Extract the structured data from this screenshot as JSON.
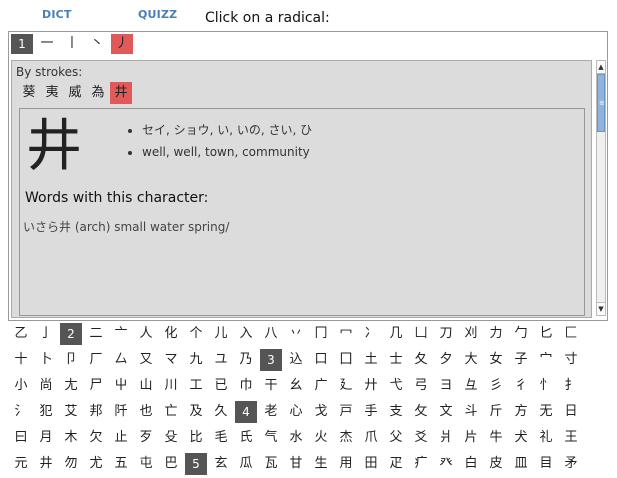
{
  "nav": {
    "dict": "DICT",
    "quizz": "QUIZZ"
  },
  "prompt": "Click on a radical:",
  "radicals": [
    {
      "text": "1",
      "kind": "num"
    },
    {
      "text": "一",
      "kind": "item"
    },
    {
      "text": "丨",
      "kind": "item"
    },
    {
      "text": "丶",
      "kind": "item"
    },
    {
      "text": "丿",
      "kind": "sel"
    }
  ],
  "panel": {
    "by_strokes_label": "By strokes:",
    "candidates": [
      {
        "text": "葵",
        "sel": false
      },
      {
        "text": "夷",
        "sel": false
      },
      {
        "text": "威",
        "sel": false
      },
      {
        "text": "為",
        "sel": false
      },
      {
        "text": "井",
        "sel": true
      }
    ],
    "detail": {
      "kanji": "井",
      "readings": "セイ, ショウ, い, いの, さい, ひ",
      "meanings": "well, well, town, community",
      "words_title": "Words with this character:",
      "words": [
        "いさら井 (arch) small water spring/"
      ]
    }
  },
  "grid_rows": [
    [
      {
        "t": "乙"
      },
      {
        "t": "亅"
      },
      {
        "t": "2",
        "n": true
      },
      {
        "t": "二"
      },
      {
        "t": "亠"
      },
      {
        "t": "人"
      },
      {
        "t": "化"
      },
      {
        "t": "个"
      },
      {
        "t": "儿"
      },
      {
        "t": "入"
      },
      {
        "t": "八"
      },
      {
        "t": "丷"
      },
      {
        "t": "冂"
      },
      {
        "t": "冖"
      },
      {
        "t": "冫"
      },
      {
        "t": "几"
      },
      {
        "t": "凵"
      },
      {
        "t": "刀"
      },
      {
        "t": "刈"
      },
      {
        "t": "力"
      },
      {
        "t": "勹"
      },
      {
        "t": "匕"
      },
      {
        "t": "匚"
      }
    ],
    [
      {
        "t": "十"
      },
      {
        "t": "卜"
      },
      {
        "t": "卩"
      },
      {
        "t": "厂"
      },
      {
        "t": "厶"
      },
      {
        "t": "又"
      },
      {
        "t": "マ"
      },
      {
        "t": "九"
      },
      {
        "t": "ユ"
      },
      {
        "t": "乃"
      },
      {
        "t": "3",
        "n": true
      },
      {
        "t": "込"
      },
      {
        "t": "口"
      },
      {
        "t": "囗"
      },
      {
        "t": "土"
      },
      {
        "t": "士"
      },
      {
        "t": "夂"
      },
      {
        "t": "夕"
      },
      {
        "t": "大"
      },
      {
        "t": "女"
      },
      {
        "t": "子"
      },
      {
        "t": "宀"
      },
      {
        "t": "寸"
      }
    ],
    [
      {
        "t": "小"
      },
      {
        "t": "尚"
      },
      {
        "t": "尢"
      },
      {
        "t": "尸"
      },
      {
        "t": "屮"
      },
      {
        "t": "山"
      },
      {
        "t": "川"
      },
      {
        "t": "工"
      },
      {
        "t": "已"
      },
      {
        "t": "巾"
      },
      {
        "t": "干"
      },
      {
        "t": "幺"
      },
      {
        "t": "广"
      },
      {
        "t": "廴"
      },
      {
        "t": "廾"
      },
      {
        "t": "弋"
      },
      {
        "t": "弓"
      },
      {
        "t": "ヨ"
      },
      {
        "t": "彑"
      },
      {
        "t": "彡"
      },
      {
        "t": "彳"
      },
      {
        "t": "忄"
      },
      {
        "t": "扌"
      }
    ],
    [
      {
        "t": "氵"
      },
      {
        "t": "犯"
      },
      {
        "t": "艾"
      },
      {
        "t": "邦"
      },
      {
        "t": "阡"
      },
      {
        "t": "也"
      },
      {
        "t": "亡"
      },
      {
        "t": "及"
      },
      {
        "t": "久"
      },
      {
        "t": "4",
        "n": true
      },
      {
        "t": "老"
      },
      {
        "t": "心"
      },
      {
        "t": "戈"
      },
      {
        "t": "戸"
      },
      {
        "t": "手"
      },
      {
        "t": "支"
      },
      {
        "t": "攵"
      },
      {
        "t": "文"
      },
      {
        "t": "斗"
      },
      {
        "t": "斤"
      },
      {
        "t": "方"
      },
      {
        "t": "无"
      },
      {
        "t": "日"
      }
    ],
    [
      {
        "t": "曰"
      },
      {
        "t": "月"
      },
      {
        "t": "木"
      },
      {
        "t": "欠"
      },
      {
        "t": "止"
      },
      {
        "t": "歹"
      },
      {
        "t": "殳"
      },
      {
        "t": "比"
      },
      {
        "t": "毛"
      },
      {
        "t": "氏"
      },
      {
        "t": "气"
      },
      {
        "t": "水"
      },
      {
        "t": "火"
      },
      {
        "t": "杰"
      },
      {
        "t": "爪"
      },
      {
        "t": "父"
      },
      {
        "t": "爻"
      },
      {
        "t": "爿"
      },
      {
        "t": "片"
      },
      {
        "t": "牛"
      },
      {
        "t": "犬"
      },
      {
        "t": "礼"
      },
      {
        "t": "王"
      }
    ],
    [
      {
        "t": "元"
      },
      {
        "t": "井"
      },
      {
        "t": "勿"
      },
      {
        "t": "尤"
      },
      {
        "t": "五"
      },
      {
        "t": "屯"
      },
      {
        "t": "巴"
      },
      {
        "t": "5",
        "n": true
      },
      {
        "t": "玄"
      },
      {
        "t": "瓜"
      },
      {
        "t": "瓦"
      },
      {
        "t": "甘"
      },
      {
        "t": "生"
      },
      {
        "t": "用"
      },
      {
        "t": "田"
      },
      {
        "t": "疋"
      },
      {
        "t": "疒"
      },
      {
        "t": "癶"
      },
      {
        "t": "白"
      },
      {
        "t": "皮"
      },
      {
        "t": "皿"
      },
      {
        "t": "目"
      },
      {
        "t": "矛"
      }
    ]
  ]
}
